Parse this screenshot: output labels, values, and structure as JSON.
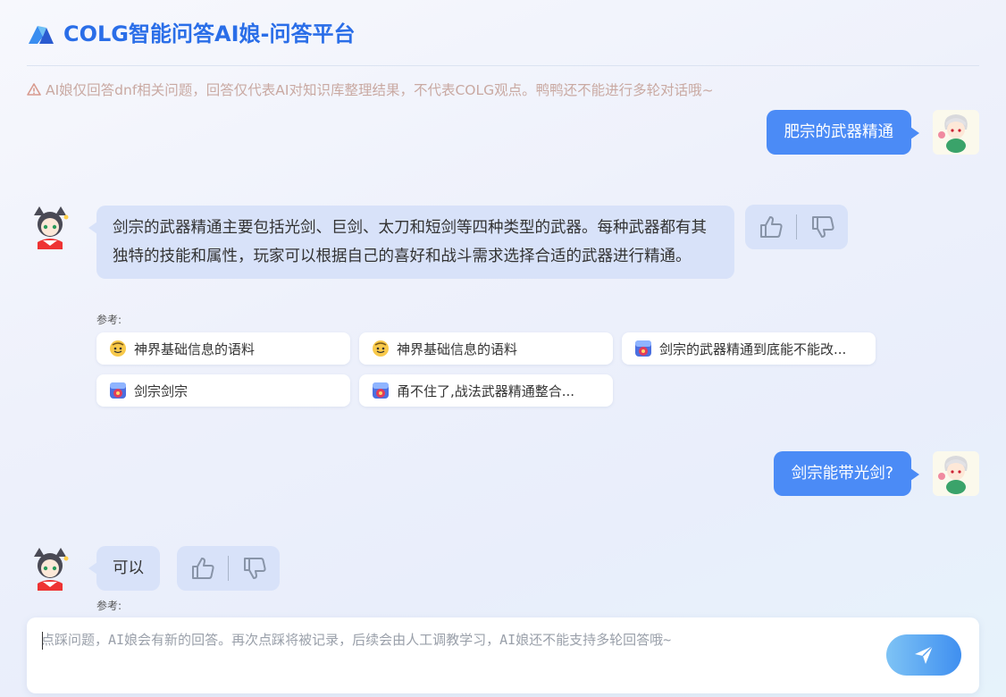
{
  "header": {
    "title": "COLG智能问答AI娘-问答平台"
  },
  "notice": {
    "text": "AI娘仅回答dnf相关问题，回答仅代表AI对知识库整理结果，不代表COLG观点。鸭鸭还不能进行多轮对话哦~"
  },
  "messages": {
    "q1": "肥宗的武器精通",
    "a1": "剑宗的武器精通主要包括光剑、巨剑、太刀和短剑等四种类型的武器。每种武器都有其独特的技能和属性，玩家可以根据自己的喜好和战斗需求选择合适的武器进行精通。",
    "ref_label": "参考:",
    "refs": [
      {
        "title": "神界基础信息的语料",
        "icon": "emoji-face-icon"
      },
      {
        "title": "神界基础信息的语料",
        "icon": "emoji-face-icon"
      },
      {
        "title": "剑宗的武器精通到底能不能改...",
        "icon": "colg-icon"
      },
      {
        "title": "剑宗剑宗",
        "icon": "colg-icon"
      },
      {
        "title": "甬不住了,战法武器精通整合...",
        "icon": "colg-icon"
      }
    ],
    "q2": "剑宗能带光剑?",
    "a2": "可以",
    "ref_label2": "参考:"
  },
  "input": {
    "placeholder": "点踩问题，AI娘会有新的回答。再次点踩将被记录，后续会由人工调教学习，AI娘还不能支持多轮回答哦~"
  },
  "colors": {
    "accent": "#2a6ee8",
    "user_bubble": "#4b8bf6",
    "ai_bubble": "#d8e2f9"
  }
}
